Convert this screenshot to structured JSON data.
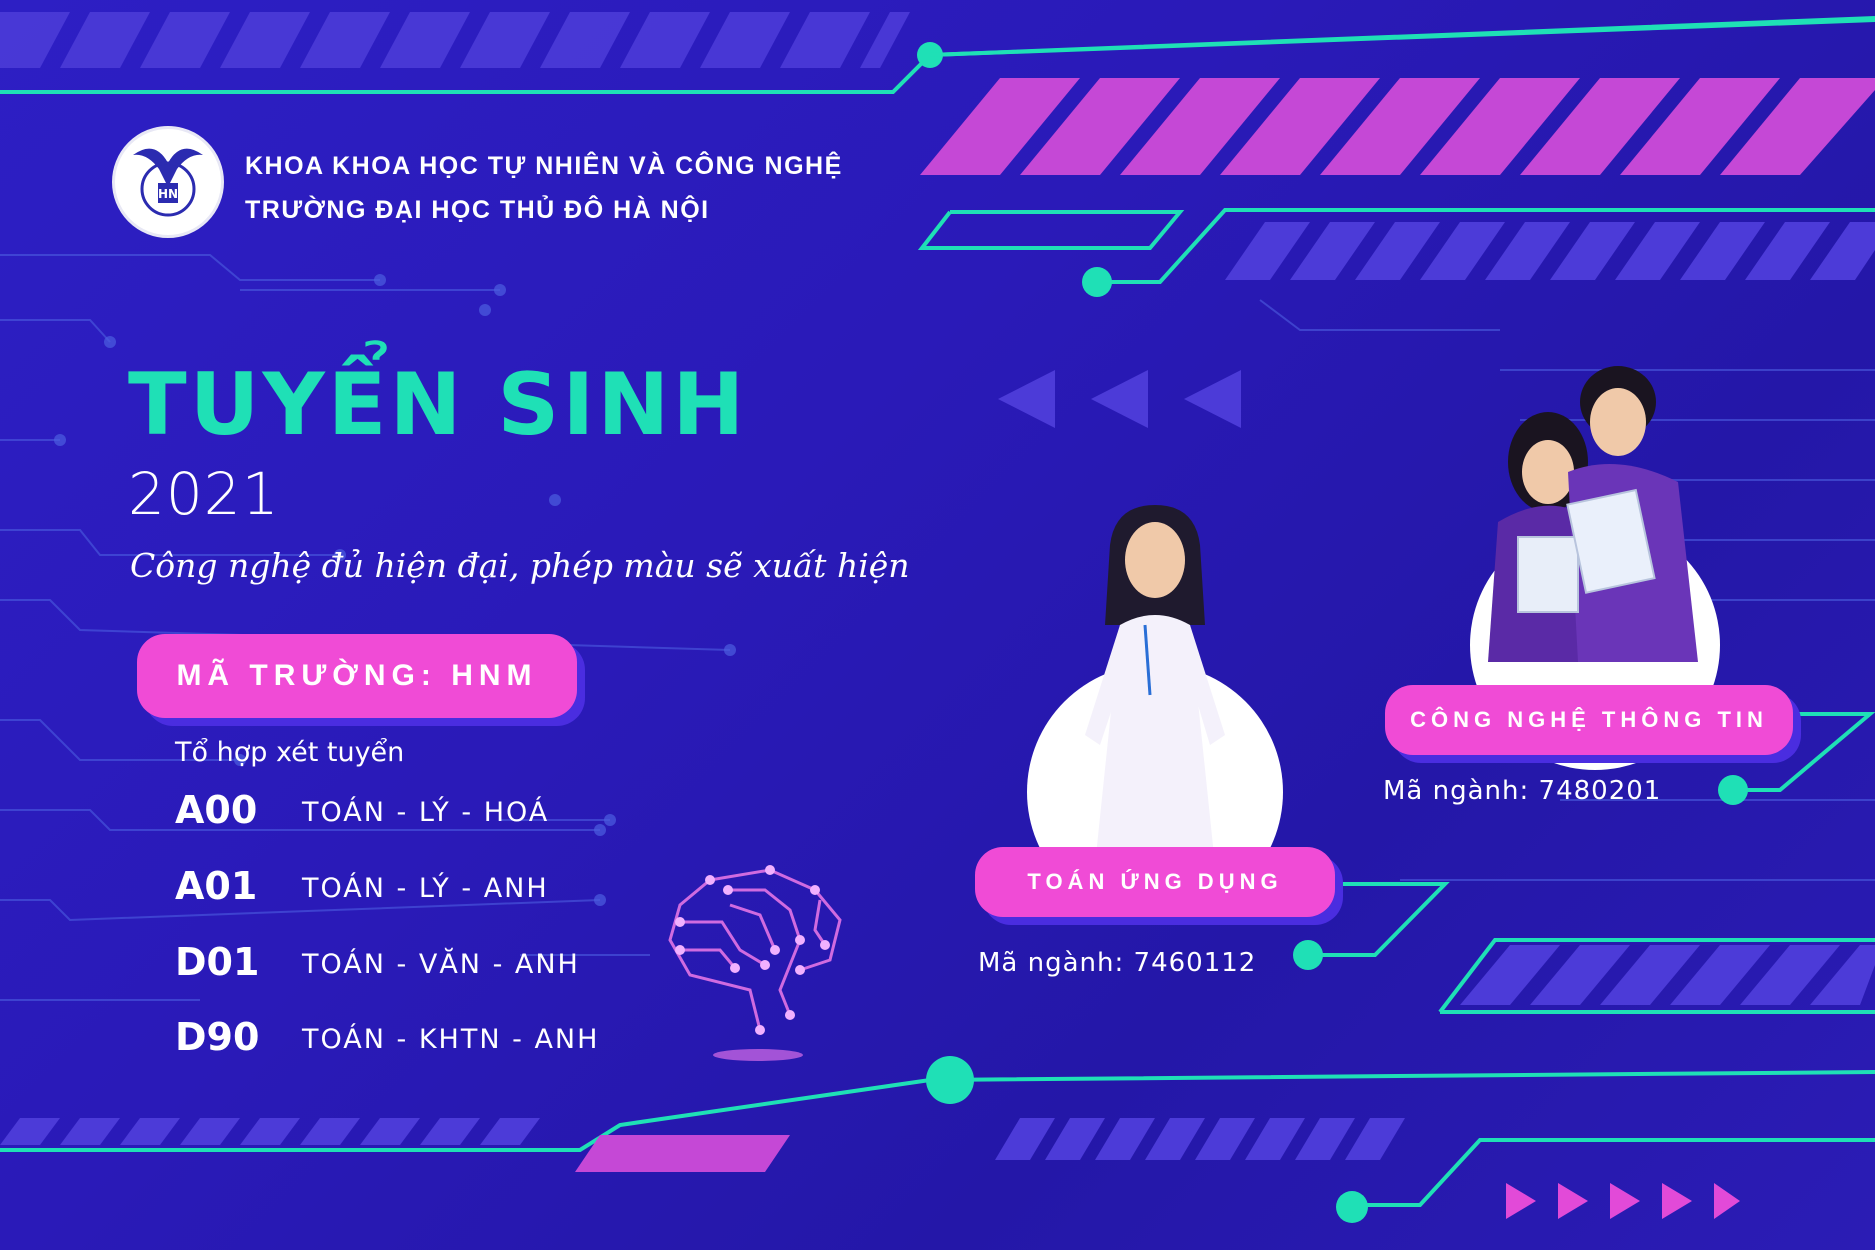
{
  "header": {
    "faculty": "KHOA KHOA HỌC TỰ NHIÊN VÀ CÔNG NGHỆ",
    "university": "TRƯỜNG ĐẠI HỌC THỦ ĐÔ HÀ NỘI"
  },
  "hero": {
    "title": "TUYỂN SINH",
    "year": "2021",
    "slogan": "Công nghệ đủ hiện đại, phép màu sẽ xuất hiện"
  },
  "school_code_label": "MÃ TRƯỜNG: HNM",
  "combinations": {
    "caption": "Tổ hợp xét tuyển",
    "items": [
      {
        "code": "A00",
        "subjects": "TOÁN - LÝ - HOÁ"
      },
      {
        "code": "A01",
        "subjects": "TOÁN - LÝ - ANH"
      },
      {
        "code": "D01",
        "subjects": "TOÁN - VĂN - ANH"
      },
      {
        "code": "D90",
        "subjects": "TOÁN - KHTN - ANH"
      }
    ]
  },
  "majors": [
    {
      "name": "TOÁN ỨNG DỤNG",
      "code_label": "Mã ngành: 7460112"
    },
    {
      "name": "CÔNG NGHỆ THÔNG TIN",
      "code_label": "Mã ngành: 7480201"
    }
  ],
  "colors": {
    "background": "#2a1ab8",
    "teal": "#1fe0b6",
    "pink": "#f04bd6",
    "purple_stripe": "#4c3bd8"
  },
  "icons": [
    "university-logo",
    "brain-circuit-icon",
    "left-arrows-icon",
    "right-arrows-icon"
  ]
}
